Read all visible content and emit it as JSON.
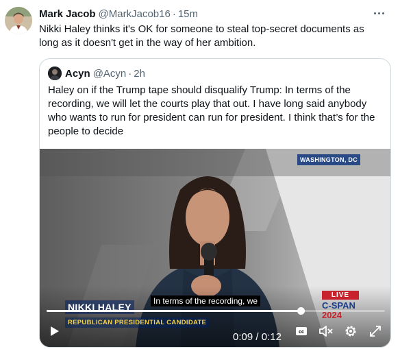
{
  "tweet": {
    "author_name": "Mark Jacob",
    "author_handle": "@MarkJacob16",
    "separator": "·",
    "time": "15m",
    "text": "Nikki Haley thinks it's OK for someone to steal top-secret documents as long as it doesn't get in the way of her ambition.",
    "more_icon": "more-horizontal-icon"
  },
  "quote": {
    "author_name": "Acyn",
    "author_handle": "@Acyn",
    "separator": "·",
    "time": "2h",
    "text": "Haley on if the Trump tape should disqualify Trump: In terms of the recording, we will let the courts play that out. I have long said anybody who wants to run for president can run for president. I think that’s for the people to decide"
  },
  "video": {
    "dateline": "WASHINGTON, DC",
    "lower_third_name": "NIKKI HALEY",
    "lower_third_title": "REPUBLICAN PRESIDENTIAL CANDIDATE",
    "live_label": "LIVE",
    "network_line1": "C-SPAN",
    "network_line2": "2024",
    "caption": "In terms of the recording, we",
    "current_time": "0:09",
    "time_separator": "/",
    "duration": "0:12",
    "progress_fraction": 0.75,
    "colors": {
      "live_red": "#c8232c",
      "cspan_blue": "#1a3c8c",
      "dateline_blue": "#2a4a86",
      "lower_title_yellow": "#f5d24a"
    }
  },
  "controls": {
    "play_icon": "play-icon",
    "cc_icon": "closed-captions-icon",
    "mute_icon": "volume-muted-icon",
    "settings_icon": "gear-icon",
    "fullscreen_icon": "fullscreen-icon"
  }
}
